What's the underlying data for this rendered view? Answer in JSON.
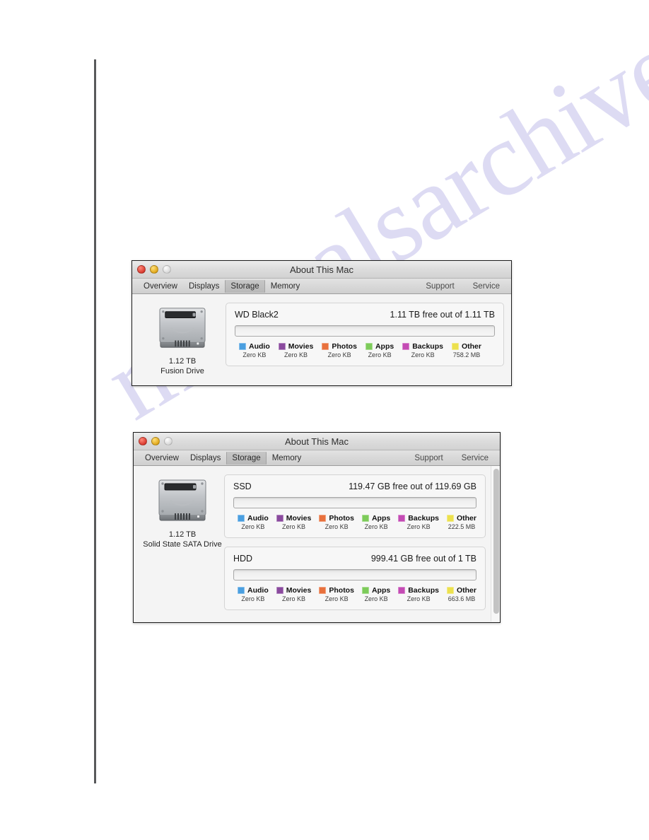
{
  "page": {
    "watermark": "manualsarchive.com"
  },
  "windows": [
    {
      "id": "window-1",
      "title": "About This Mac",
      "traffic_lights": [
        "close-button",
        "minimize-button",
        "zoom-button"
      ],
      "tabs": [
        {
          "label": "Overview",
          "selected": false
        },
        {
          "label": "Displays",
          "selected": false
        },
        {
          "label": "Storage",
          "selected": true
        },
        {
          "label": "Memory",
          "selected": false
        }
      ],
      "toolbar_right": [
        {
          "label": "Support"
        },
        {
          "label": "Service"
        }
      ],
      "drive": {
        "icon": "hard-drive-icon",
        "capacity": "1.12 TB",
        "name": "Fusion Drive"
      },
      "volumes": [
        {
          "name": "WD Black2",
          "free": "1.11 TB free out of 1.11 TB",
          "legend": [
            {
              "label": "Audio",
              "value": "Zero KB",
              "color": "#4a9fe0"
            },
            {
              "label": "Movies",
              "value": "Zero KB",
              "color": "#8a4a9e"
            },
            {
              "label": "Photos",
              "value": "Zero KB",
              "color": "#e8713d"
            },
            {
              "label": "Apps",
              "value": "Zero KB",
              "color": "#7dcb5a"
            },
            {
              "label": "Backups",
              "value": "Zero KB",
              "color": "#c44bb4"
            },
            {
              "label": "Other",
              "value": "758.2 MB",
              "color": "#ece14e"
            }
          ]
        }
      ],
      "has_scrollbar": false
    },
    {
      "id": "window-2",
      "title": "About This Mac",
      "traffic_lights": [
        "close-button",
        "minimize-button",
        "zoom-button"
      ],
      "tabs": [
        {
          "label": "Overview",
          "selected": false
        },
        {
          "label": "Displays",
          "selected": false
        },
        {
          "label": "Storage",
          "selected": true
        },
        {
          "label": "Memory",
          "selected": false
        }
      ],
      "toolbar_right": [
        {
          "label": "Support"
        },
        {
          "label": "Service"
        }
      ],
      "drive": {
        "icon": "hard-drive-icon",
        "capacity": "1.12 TB",
        "name": "Solid State SATA Drive"
      },
      "volumes": [
        {
          "name": "SSD",
          "free": "119.47 GB free out of 119.69 GB",
          "legend": [
            {
              "label": "Audio",
              "value": "Zero KB",
              "color": "#4a9fe0"
            },
            {
              "label": "Movies",
              "value": "Zero KB",
              "color": "#8a4a9e"
            },
            {
              "label": "Photos",
              "value": "Zero KB",
              "color": "#e8713d"
            },
            {
              "label": "Apps",
              "value": "Zero KB",
              "color": "#7dcb5a"
            },
            {
              "label": "Backups",
              "value": "Zero KB",
              "color": "#c44bb4"
            },
            {
              "label": "Other",
              "value": "222.5 MB",
              "color": "#ece14e"
            }
          ]
        },
        {
          "name": "HDD",
          "free": "999.41 GB free out of 1 TB",
          "legend": [
            {
              "label": "Audio",
              "value": "Zero KB",
              "color": "#4a9fe0"
            },
            {
              "label": "Movies",
              "value": "Zero KB",
              "color": "#8a4a9e"
            },
            {
              "label": "Photos",
              "value": "Zero KB",
              "color": "#e8713d"
            },
            {
              "label": "Apps",
              "value": "Zero KB",
              "color": "#7dcb5a"
            },
            {
              "label": "Backups",
              "value": "Zero KB",
              "color": "#c44bb4"
            },
            {
              "label": "Other",
              "value": "663.6 MB",
              "color": "#ece14e"
            }
          ]
        }
      ],
      "has_scrollbar": true
    }
  ]
}
